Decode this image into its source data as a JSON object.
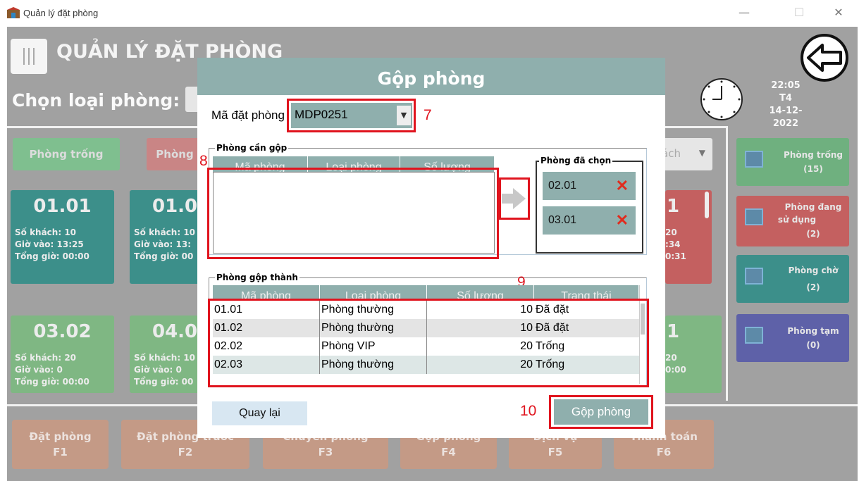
{
  "window": {
    "title": "Quản lý đặt phòng",
    "minimize": "—",
    "maximize": "☐",
    "close": "✕"
  },
  "header": {
    "title": "QUẢN LÝ ĐẶT PHÒNG",
    "chon_loai_phong": "Chọn loại phòng:",
    "time": "22:05",
    "day": "T4",
    "date": "14-12-2022"
  },
  "filters": [
    {
      "label": "Phòng trống",
      "color": "#7fbf8f"
    },
    {
      "label": "Phòng",
      "color": "#c98585"
    }
  ],
  "filter_right": "ách",
  "side_cards": [
    {
      "label1": "Phòng trống",
      "label2": "(15)",
      "color": "#6fb07f"
    },
    {
      "label1": "Phòng đang",
      "label2": "sử dụng",
      "label3": "(2)",
      "color": "#c46060"
    },
    {
      "label1": "Phòng chờ",
      "label2": "(2)",
      "color": "#3c8f8a"
    },
    {
      "label1": "Phòng tạm",
      "label2": "(0)",
      "color": "#5e61a8"
    }
  ],
  "rooms_row1": [
    {
      "num": "01.01",
      "l1": "Số khách: 10",
      "l2": "Giờ vào: 13:25",
      "l3": "Tổng giờ: 00:00",
      "color": "#3c8f8a"
    },
    {
      "num": "01.0",
      "l1": "Số khách: 10",
      "l2": "Giờ vào: 13:",
      "l3": "Tổng giờ: 00",
      "color": "#3c8f8a"
    },
    {
      "num": "1",
      "l1": "20",
      "l2": ":34",
      "l3": "0:31",
      "color": "#c46060"
    }
  ],
  "rooms_row2": [
    {
      "num": "03.02",
      "l1": "Số khách: 20",
      "l2": "Giờ vào: 0",
      "l3": "Tổng giờ: 00:00",
      "color": "#7fb783"
    },
    {
      "num": "04.0",
      "l1": "Số khách: 10",
      "l2": "Giờ vào: 0",
      "l3": "Tổng giờ: 00",
      "color": "#7fb783"
    },
    {
      "num": "1",
      "l1": "20",
      "l2": "",
      "l3": "0:00",
      "color": "#7fb783"
    }
  ],
  "bottom_buttons": [
    {
      "label": "Đặt phòng",
      "key": "F1"
    },
    {
      "label": "Đặt phòng trước",
      "key": "F2"
    },
    {
      "label": "Chuyển phòng",
      "key": "F3"
    },
    {
      "label": "Gộp phòng",
      "key": "F4"
    },
    {
      "label": "Dịch vụ",
      "key": "F5"
    },
    {
      "label": "Thanh toán",
      "key": "F6"
    }
  ],
  "dialog": {
    "title": "Gộp phòng",
    "ma_dat_phong_label": "Mã đặt phòng",
    "ma_dat_phong_value": "MDP0251",
    "phong_can_gop": "Phòng cần gộp",
    "phong_can_gop_cols": [
      "Mã phòng",
      "Loại phòng",
      "Số lượng"
    ],
    "phong_da_chon": "Phòng đã chọn",
    "selected": [
      "02.01",
      "03.01"
    ],
    "phong_gop_thanh": "Phòng gộp thành",
    "result_cols": [
      "Mã phòng",
      "Loại phòng",
      "Số lượng",
      "Trạng thái"
    ],
    "result_rows": [
      {
        "ma": "01.01",
        "loai": "Phòng thường",
        "sl": "10",
        "tt": "Đã đặt"
      },
      {
        "ma": "01.02",
        "loai": "Phòng thường",
        "sl": "10",
        "tt": "Đã đặt"
      },
      {
        "ma": "02.02",
        "loai": "Phòng VIP",
        "sl": "20",
        "tt": "Trống"
      },
      {
        "ma": "02.03",
        "loai": "Phòng thường",
        "sl": "20",
        "tt": "Trống"
      }
    ],
    "quay_lai": "Quay lại",
    "gop_phong_btn": "Gộp phòng"
  },
  "markers": {
    "m7": "7",
    "m8": "8",
    "m9": "9",
    "m10": "10"
  }
}
